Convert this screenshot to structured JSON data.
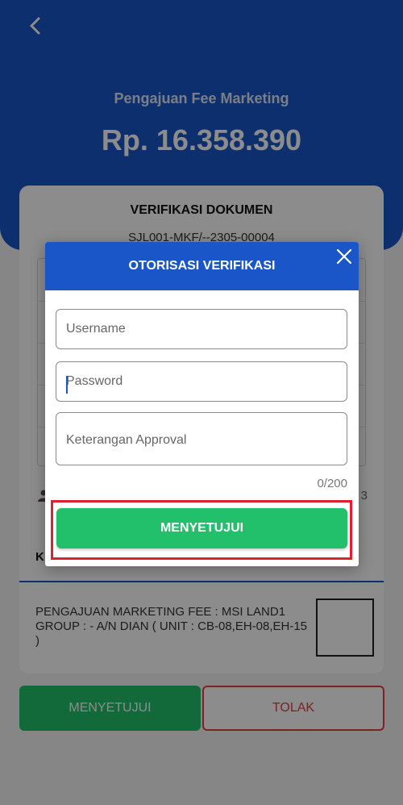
{
  "header": {
    "title": "Pengajuan Fee Marketing",
    "amount": "Rp. 16.358.390"
  },
  "card": {
    "title": "VERIFIKASI DOKUMEN",
    "code": "SJL001-MKF/--2305-00004",
    "meta_right": "3",
    "tab_label": "K",
    "description": "PENGAJUAN MARKETING FEE : MSI LAND1 GROUP : - A/N DIAN ( UNIT : CB-08,EH-08,EH-15 )"
  },
  "actions": {
    "approve_label": "MENYETUJUI",
    "reject_label": "TOLAK"
  },
  "dialog": {
    "title": "OTORISASI VERIFIKASI",
    "username": {
      "value": "",
      "placeholder": "Username"
    },
    "password": {
      "value": "",
      "placeholder": "Password"
    },
    "note": {
      "value": "",
      "placeholder": "Keterangan Approval"
    },
    "counter": "0/200",
    "approve_label": "MENYETUJUI"
  },
  "colors": {
    "primary_blue": "#1a56c8",
    "approve_green": "#22c06a",
    "reject_red": "#e04040",
    "highlight_red": "#e02030"
  }
}
